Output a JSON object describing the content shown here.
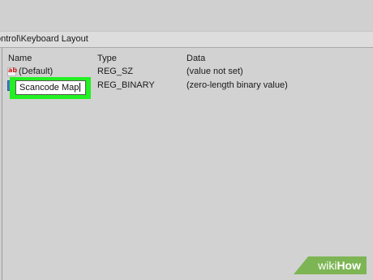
{
  "address_bar": {
    "path": "ontrol\\Keyboard Layout"
  },
  "columns": {
    "name": "Name",
    "type": "Type",
    "data": "Data"
  },
  "rows": [
    {
      "icon": "string-value-icon",
      "name": "(Default)",
      "type": "REG_SZ",
      "data": "(value not set)"
    },
    {
      "icon": "binary-value-icon",
      "name": "Scancode Map",
      "type": "REG_BINARY",
      "data": "(zero-length binary value)",
      "editing": true
    }
  ],
  "colors": {
    "highlight": "#22f022",
    "watermark": "#7db554"
  },
  "watermark": {
    "part1": "wiki",
    "part2": "How"
  }
}
